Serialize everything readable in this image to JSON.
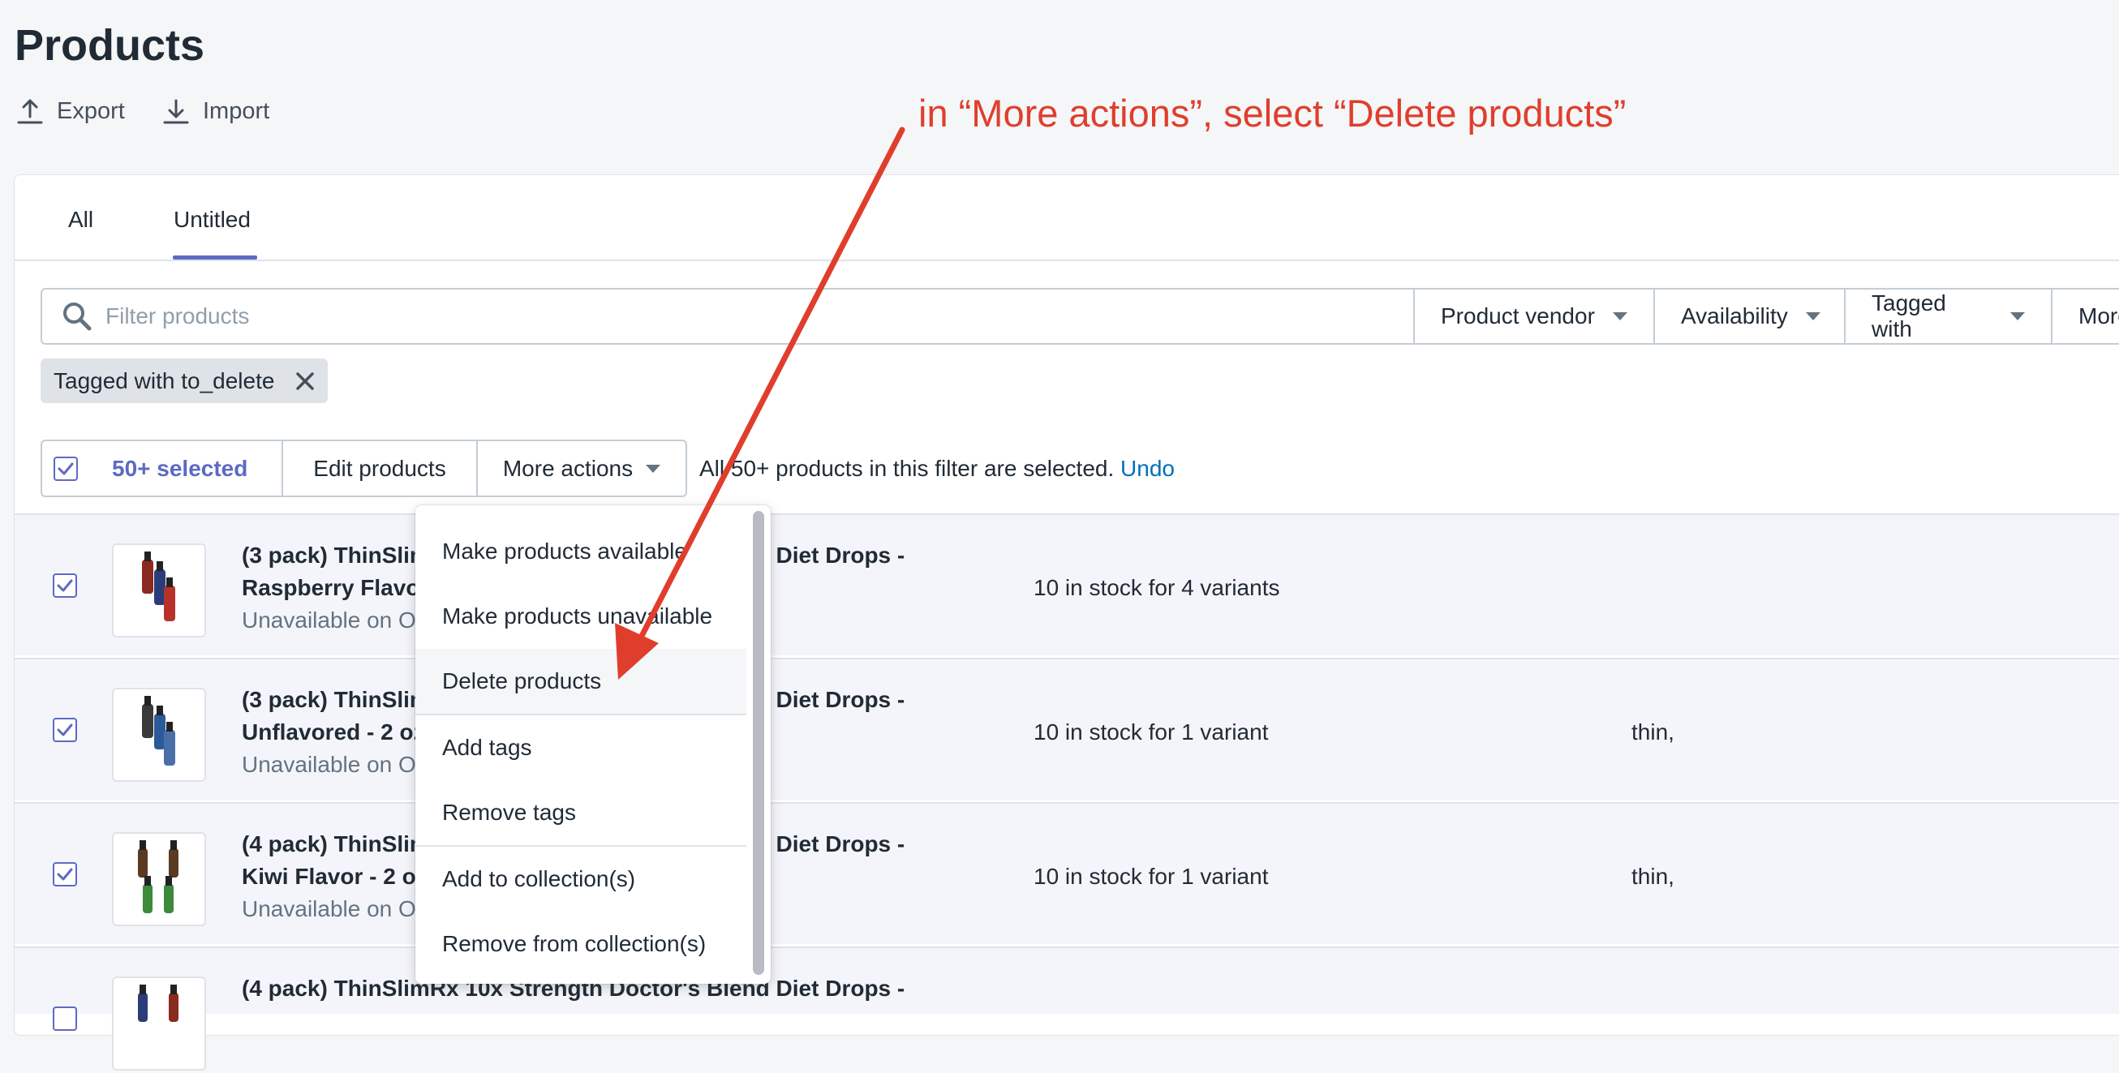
{
  "page": {
    "title": "Products",
    "actions": [
      {
        "label": "Export",
        "icon": "export-icon"
      },
      {
        "label": "Import",
        "icon": "import-icon"
      }
    ]
  },
  "tabs": [
    {
      "label": "All",
      "active": false
    },
    {
      "label": "Untitled",
      "active": true
    }
  ],
  "filters": {
    "placeholder": "Filter products",
    "buttons": [
      "Product vendor",
      "Availability",
      "Tagged with",
      "More filters"
    ],
    "chip": "Tagged with to_delete"
  },
  "bulk": {
    "selected": "50+ selected",
    "edit": "Edit products",
    "more": "More actions",
    "message": "All 50+ products in this filter are selected.",
    "undo": "Undo"
  },
  "menu": {
    "items": [
      "Make products available",
      "Make products unavailable",
      "Delete products",
      "Add tags",
      "Remove tags",
      "Add to collection(s)",
      "Remove from collection(s)"
    ],
    "highlighted_index": 2
  },
  "rows": [
    {
      "line1": "(3 pack) ThinSlimRx 10x Strength Doctor's Blend Diet Drops -",
      "line2": "Raspberry Flavor - 2 oz Bottle",
      "sub": "Unavailable on Online Store",
      "stock": "10 in stock for 4 variants",
      "tag": "",
      "checked": true
    },
    {
      "line1": "(3 pack) ThinSlimRx 10x Strength Doctor's Blend Diet Drops -",
      "line2": "Unflavored - 2 oz Bottle",
      "sub": "Unavailable on Online Store",
      "stock": "10 in stock for 1 variant",
      "tag": "thin,",
      "checked": true
    },
    {
      "line1": "(4 pack) ThinSlimRx 10x Strength Doctor's Blend Diet Drops -",
      "line2": "Kiwi Flavor - 2 oz Bottle",
      "sub": "Unavailable on Online Store",
      "stock": "10 in stock for 1 variant",
      "tag": "thin,",
      "checked": true
    },
    {
      "line1": "(4 pack) ThinSlimRx 10x Strength Doctor's Blend Diet Drops -",
      "line2": "",
      "sub": "",
      "stock": "",
      "tag": "",
      "checked": true
    }
  ],
  "annotation": "in “More actions”, select “Delete products”",
  "colors": {
    "accent": "#5c6ac4",
    "link": "#006fbb",
    "annotation": "#e03e2d"
  }
}
